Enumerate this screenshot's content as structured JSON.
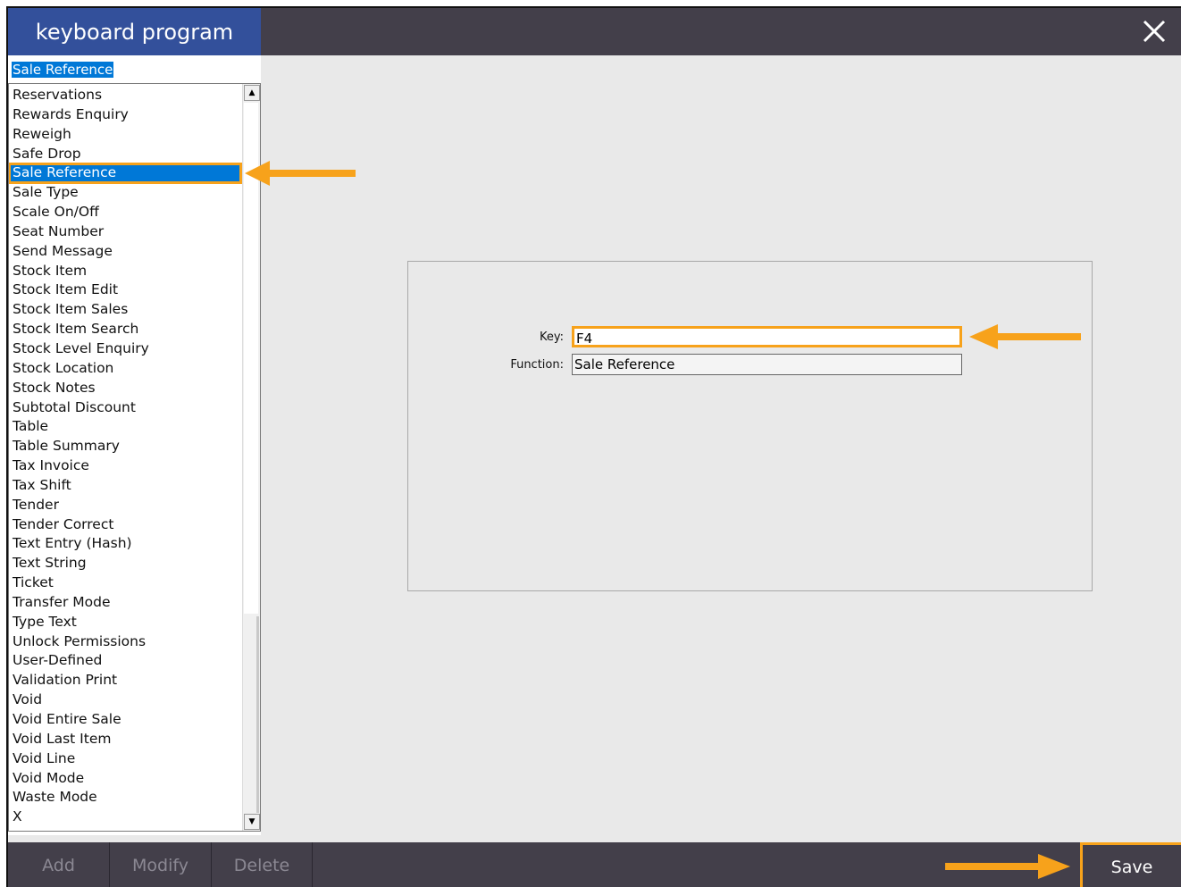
{
  "window": {
    "title": "keyboard program"
  },
  "search": {
    "value": "Sale Reference"
  },
  "list": {
    "items": [
      "Reservations",
      "Rewards Enquiry",
      "Reweigh",
      "Safe Drop",
      "Sale Reference",
      "Sale Type",
      "Scale On/Off",
      "Seat Number",
      "Send Message",
      "Stock Item",
      "Stock Item Edit",
      "Stock Item Sales",
      "Stock Item Search",
      "Stock Level Enquiry",
      "Stock Location",
      "Stock Notes",
      "Subtotal Discount",
      "Table",
      "Table Summary",
      "Tax Invoice",
      "Tax Shift",
      "Tender",
      "Tender Correct",
      "Text Entry (Hash)",
      "Text String",
      "Ticket",
      "Transfer Mode",
      "Type Text",
      "Unlock Permissions",
      "User-Defined",
      "Validation Print",
      "Void",
      "Void Entire Sale",
      "Void Last Item",
      "Void Line",
      "Void Mode",
      "Waste Mode",
      "X"
    ],
    "selected_index": 4
  },
  "form": {
    "key_label": "Key:",
    "key_value": "F4",
    "function_label": "Function:",
    "function_value": "Sale Reference"
  },
  "buttons": {
    "add": "Add",
    "modify": "Modify",
    "delete": "Delete",
    "save": "Save"
  },
  "colors": {
    "titlebar": "#433f4a",
    "title_accent": "#33509b",
    "selection": "#0078d7",
    "highlight": "#f7a21b"
  },
  "icons": {
    "close": "close-icon",
    "scroll_up": "scroll-up-icon",
    "scroll_down": "scroll-down-icon",
    "annotation_arrow": "arrow-left-icon"
  }
}
